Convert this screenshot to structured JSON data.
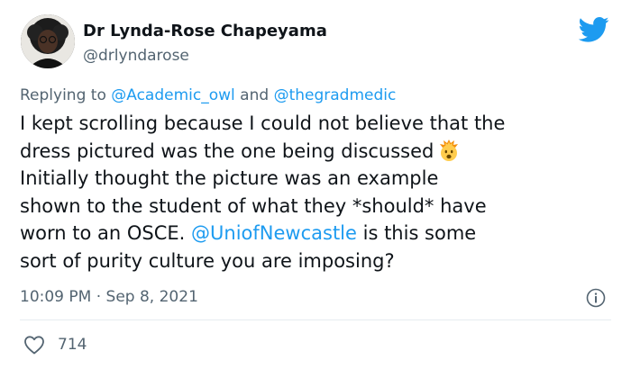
{
  "author": {
    "display_name": "Dr Lynda-Rose Chapeyama",
    "handle": "@drlyndarose"
  },
  "reply": {
    "prefix": "Replying to",
    "mention_1": "@Academic_owl",
    "conjunction": "and",
    "mention_2": "@thegradmedic"
  },
  "tweet": {
    "line_1": "I kept scrolling because I could not believe that the",
    "line_2": "dress pictured was the one being discussed",
    "line_3": " Initially thought the picture was an example",
    "line_4": "shown to the student of what they *should* have",
    "line_5_before": "worn to an OSCE. ",
    "line_5_mention": "@UniofNewcastle",
    "line_5_after": " is this some",
    "line_6": "sort of purity culture you are imposing?",
    "emoji": "exploding-head-emoji"
  },
  "meta": {
    "time": "10:09 PM",
    "separator": "·",
    "date": "Sep 8, 2021"
  },
  "stats": {
    "likes": "714"
  },
  "colors": {
    "link": "#1d9bf0",
    "secondary_text": "#536471",
    "primary_text": "#0f1419",
    "divider": "#e6ecf0",
    "twitter_bird": "#1d9bf0"
  },
  "icons": {
    "brand": "twitter-bird-icon",
    "info": "info-icon",
    "like": "heart-icon"
  }
}
